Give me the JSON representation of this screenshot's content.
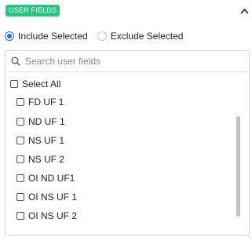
{
  "header": {
    "badge_label": "USER FIELDS",
    "badge_color": "#2bc483",
    "collapse_icon": "chevron-up-icon"
  },
  "selection_mode": {
    "options": [
      {
        "label": "Include Selected",
        "selected": true
      },
      {
        "label": "Exclude Selected",
        "selected": false
      }
    ],
    "accent_color": "#1f6feb"
  },
  "search": {
    "placeholder": "Search user fields",
    "value": "",
    "icon": "search-icon"
  },
  "fields": {
    "select_all_label": "Select All",
    "items": [
      {
        "label": "FD UF 1",
        "checked": false
      },
      {
        "label": "ND UF 1",
        "checked": false
      },
      {
        "label": "NS UF 1",
        "checked": false
      },
      {
        "label": "NS UF 2",
        "checked": false
      },
      {
        "label": "OI ND UF1",
        "checked": false
      },
      {
        "label": "OI NS UF 1",
        "checked": false
      },
      {
        "label": "OI NS UF 2",
        "checked": false
      }
    ]
  }
}
